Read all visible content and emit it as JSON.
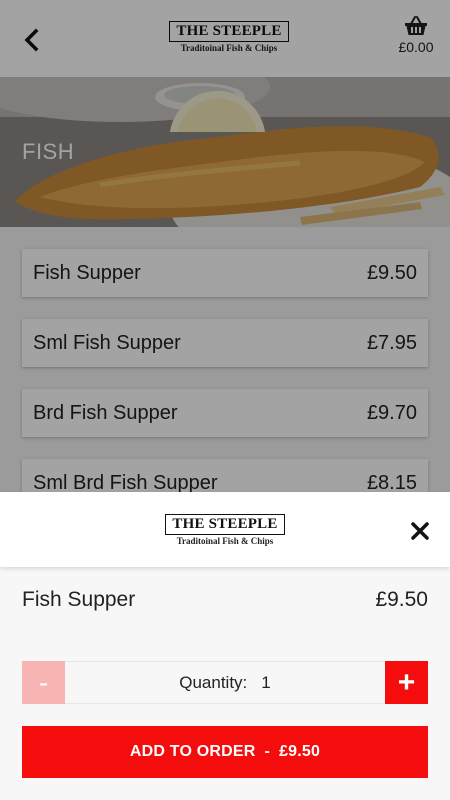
{
  "header": {
    "logo_title": "THE STEEPLE",
    "logo_subtitle": "Traditoinal Fish & Chips",
    "basket_total": "£0.00"
  },
  "category": {
    "title": "FISH"
  },
  "menu": {
    "items": [
      {
        "name": "Fish Supper",
        "price": "£9.50"
      },
      {
        "name": "Sml Fish Supper",
        "price": "£7.95"
      },
      {
        "name": "Brd Fish Supper",
        "price": "£9.70"
      },
      {
        "name": "Sml Brd Fish Supper",
        "price": "£8.15"
      }
    ]
  },
  "modal": {
    "logo_title": "THE STEEPLE",
    "logo_subtitle": "Traditoinal Fish & Chips",
    "product_name": "Fish Supper",
    "product_price": "£9.50",
    "minus_label": "-",
    "plus_label": "+",
    "quantity_label": "Quantity:",
    "quantity_value": "1",
    "add_label": "ADD TO ORDER",
    "add_separator": "-",
    "add_price": "£9.50"
  },
  "colors": {
    "accent_red": "#f50d0d",
    "disabled_red": "#f8b3b3"
  },
  "icons": {
    "back": "chevron-left-icon",
    "basket": "basket-icon",
    "close": "close-icon"
  }
}
